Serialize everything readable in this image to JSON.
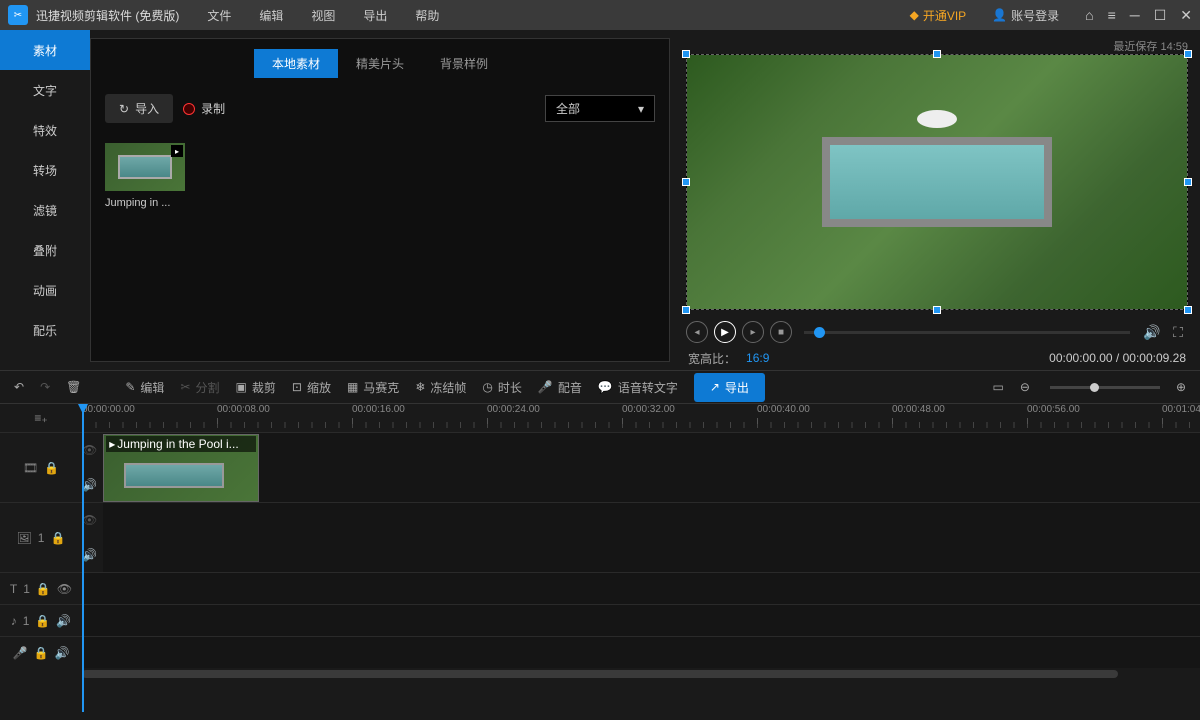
{
  "app_title": "迅捷视频剪辑软件 (免费版)",
  "menu": [
    "文件",
    "编辑",
    "视图",
    "导出",
    "帮助"
  ],
  "vip_label": "开通VIP",
  "account_label": "账号登录",
  "save_time": "最近保存 14:59",
  "sidebar": [
    "素材",
    "文字",
    "特效",
    "转场",
    "滤镜",
    "叠附",
    "动画",
    "配乐"
  ],
  "sidebar_active": 0,
  "panel_tabs": [
    "本地素材",
    "精美片头",
    "背景样例"
  ],
  "panel_tab_active": 0,
  "import_label": "导入",
  "record_label": "录制",
  "filter_label": "全部",
  "media": {
    "name": "Jumping in ..."
  },
  "aspect_label": "宽高比：",
  "aspect_value": "16:9",
  "time_current": "00:00:00.00",
  "time_total": "00:00:09.28",
  "toolbar": {
    "edit": "编辑",
    "split": "分割",
    "crop": "裁剪",
    "zoom": "缩放",
    "mosaic": "马赛克",
    "freeze": "冻结帧",
    "duration": "时长",
    "voiceover": "配音",
    "stt": "语音转文字",
    "export": "导出"
  },
  "ruler": [
    "00:00:00.00",
    "00:00:08.00",
    "00:00:16.00",
    "00:00:24.00",
    "00:00:32.00",
    "00:00:40.00",
    "00:00:48.00",
    "00:00:56.00",
    "00:01:04"
  ],
  "clip_name": "Jumping in the Pool i...",
  "track_labels": {
    "img": "1",
    "text": "1",
    "audio": "1"
  }
}
